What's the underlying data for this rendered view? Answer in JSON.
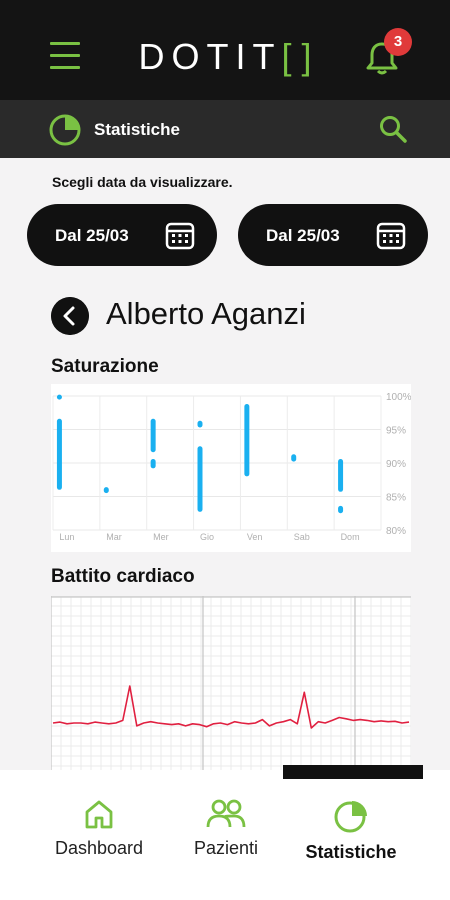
{
  "header": {
    "logo_text": "DOTIT",
    "logo_brackets": "[ ]",
    "notification_count": "3"
  },
  "section": {
    "title": "Statistiche"
  },
  "date_filter": {
    "prompt": "Scegli data da visualizzare.",
    "from_label": "Dal 25/03",
    "to_label": "Dal 25/03"
  },
  "patient": {
    "name": "Alberto Aganzi"
  },
  "colors": {
    "accent": "#7ac143",
    "saturation_bar": "#1ab0f0",
    "ecg_line": "#e02040",
    "dark": "#141414"
  },
  "charts": {
    "saturation_title": "Saturazione",
    "heart_title": "Battito cardiaco"
  },
  "chart_data": [
    {
      "type": "bar",
      "subtype": "range",
      "title": "Saturazione",
      "categories": [
        "Lun",
        "Mar",
        "Mer",
        "Gio",
        "Ven",
        "Sab",
        "Dom"
      ],
      "y_ticks": [
        "100%",
        "95%",
        "90%",
        "85%",
        "80%"
      ],
      "ylim": [
        80,
        100
      ],
      "grid": true,
      "series": [
        {
          "values": [
            [
              99.5,
              100.2
            ],
            [
              86,
              96.6
            ],
            [
              85.5,
              86.4
            ],
            [
              89.2,
              90.6
            ],
            [
              91.6,
              96.6
            ],
            [
              95.3,
              96.3
            ],
            [
              82.7,
              92.5
            ],
            [
              88,
              98.8
            ],
            [
              90.2,
              91.3
            ],
            [
              82.5,
              83.6
            ],
            [
              85.7,
              90.6
            ]
          ],
          "category_index": [
            0,
            0,
            1,
            2,
            2,
            3,
            3,
            4,
            5,
            6,
            6
          ]
        }
      ]
    },
    {
      "type": "line",
      "title": "Battito cardiaco",
      "grid": true,
      "series": [
        {
          "values": [
            0.12,
            0.14,
            0.1,
            0.12,
            0.12,
            0.1,
            0.14,
            0.12,
            0.1,
            0.12,
            0.18,
            1.0,
            0.05,
            0.12,
            0.15,
            0.12,
            0.1,
            0.08,
            0.1,
            0.05,
            0.1,
            0.08,
            0.03,
            0.1,
            0.12,
            0.08,
            0.15,
            0.12,
            0.1,
            0.12,
            0.2,
            0.05,
            0.12,
            0.15,
            0.2,
            0.1,
            0.85,
            0.0,
            0.15,
            0.12,
            0.18,
            0.25,
            0.22,
            0.18,
            0.2,
            0.18,
            0.15,
            0.17,
            0.15,
            0.16,
            0.12,
            0.14
          ]
        }
      ]
    }
  ],
  "nav": {
    "dashboard": "Dashboard",
    "pazienti": "Pazienti",
    "statistiche": "Statistiche"
  }
}
